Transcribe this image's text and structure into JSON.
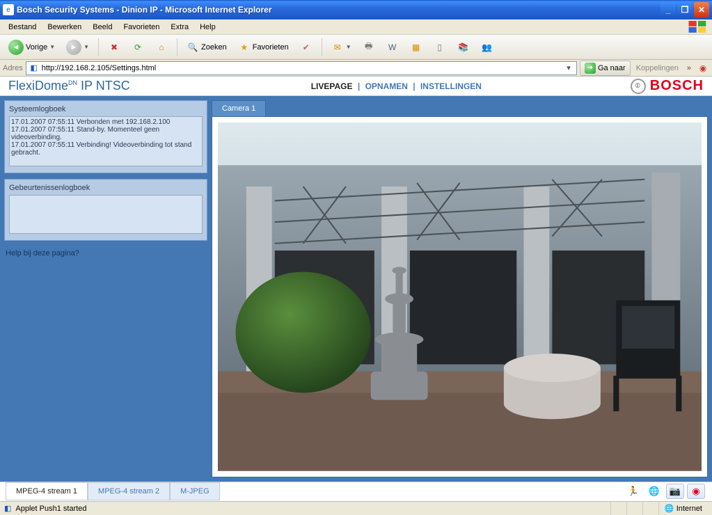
{
  "window": {
    "title": "Bosch Security Systems - Dinion IP - Microsoft Internet Explorer"
  },
  "menu": {
    "items": [
      "Bestand",
      "Bewerken",
      "Beeld",
      "Favorieten",
      "Extra",
      "Help"
    ]
  },
  "toolbar": {
    "back": "Vorige",
    "search": "Zoeken",
    "favorites": "Favorieten"
  },
  "address": {
    "label": "Adres",
    "url": "http://192.168.2.105/Settings.html",
    "go": "Ga naar",
    "links": "Koppelingen"
  },
  "brand": {
    "name_prefix": "FlexiDome",
    "name_sup": "DN",
    "name_suffix": " IP NTSC",
    "logo_text": "BOSCH"
  },
  "nav": {
    "livepage": "LIVEPAGE",
    "opnamen": "OPNAMEN",
    "instellingen": "INSTELLINGEN"
  },
  "left": {
    "syslog_title": "Systeemlogboek",
    "syslog_text": "17.01.2007 07:55:11 Verbonden met 192.168.2.100\n17.01.2007 07:55:11 Stand-by. Momenteel geen videoverbinding.\n17.01.2007 07:55:11 Verbinding! Videoverbinding tot stand gebracht.",
    "eventlog_title": "Gebeurtenissenlogboek",
    "eventlog_text": "",
    "help": "Help bij deze pagina?"
  },
  "camera": {
    "tab": "Camera 1"
  },
  "streams": {
    "s1": "MPEG-4 stream 1",
    "s2": "MPEG-4 stream 2",
    "s3": "M-JPEG"
  },
  "status": {
    "text": "Applet Push1 started",
    "zone": "Internet"
  }
}
